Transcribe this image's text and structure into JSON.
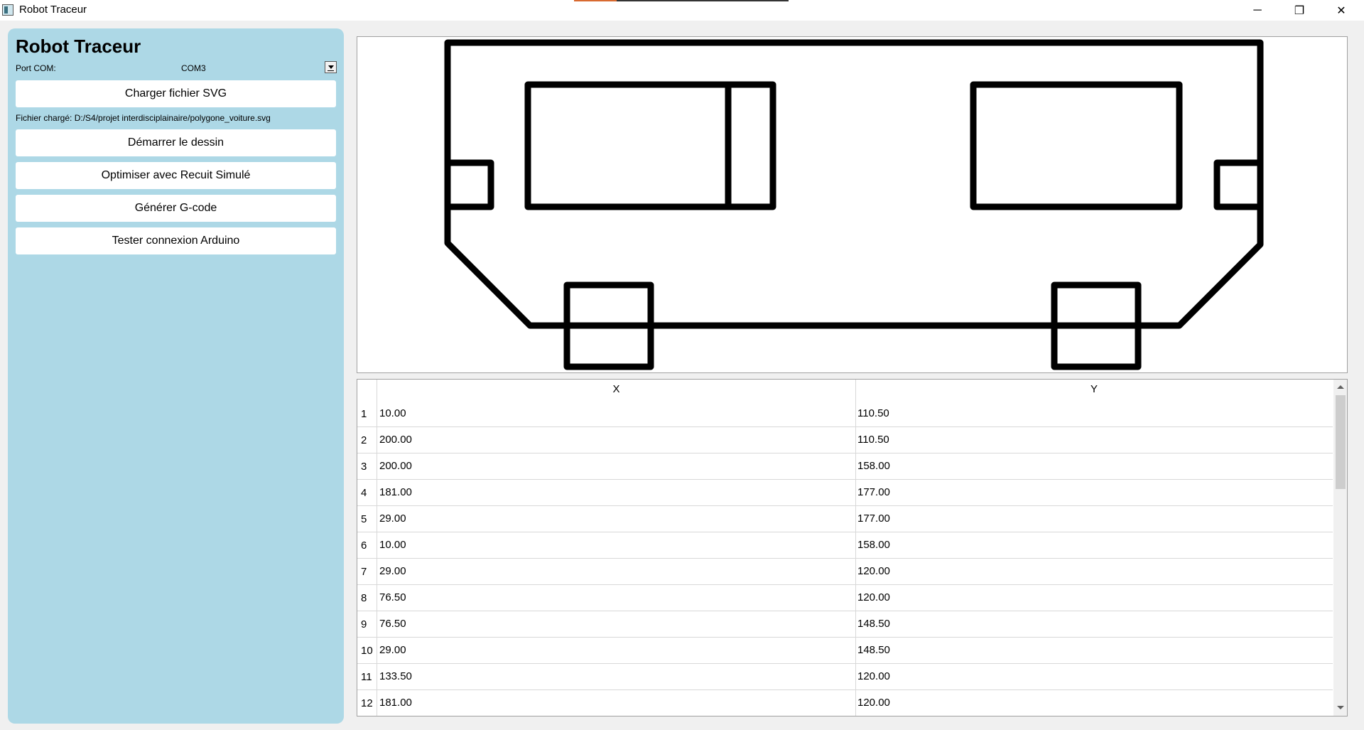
{
  "window": {
    "title": "Robot Traceur",
    "minimize_glyph": "─",
    "maximize_glyph": "❐",
    "close_glyph": "✕"
  },
  "sidebar": {
    "title": "Robot Traceur",
    "port_label": "Port COM:",
    "port_value": "COM3",
    "load_button": "Charger fichier SVG",
    "loaded_file": "Fichier chargé: D:/S4/projet interdisciplainaire/polygone_voiture.svg",
    "start_button": "Démarrer le dessin",
    "optimize_button": "Optimiser avec Recuit Simulé",
    "gcode_button": "Générer G-code",
    "test_button": "Tester connexion Arduino",
    "background_color": "#add8e6"
  },
  "table": {
    "headers": [
      "X",
      "Y"
    ],
    "rows": [
      {
        "n": "1",
        "x": "10.00",
        "y": "110.50"
      },
      {
        "n": "2",
        "x": "200.00",
        "y": "110.50"
      },
      {
        "n": "3",
        "x": "200.00",
        "y": "158.00"
      },
      {
        "n": "4",
        "x": "181.00",
        "y": "177.00"
      },
      {
        "n": "5",
        "x": "29.00",
        "y": "177.00"
      },
      {
        "n": "6",
        "x": "10.00",
        "y": "158.00"
      },
      {
        "n": "7",
        "x": "29.00",
        "y": "120.00"
      },
      {
        "n": "8",
        "x": "76.50",
        "y": "120.00"
      },
      {
        "n": "9",
        "x": "76.50",
        "y": "148.50"
      },
      {
        "n": "10",
        "x": "29.00",
        "y": "148.50"
      },
      {
        "n": "11",
        "x": "133.50",
        "y": "120.00"
      },
      {
        "n": "12",
        "x": "181.00",
        "y": "120.00"
      }
    ]
  },
  "drawing": {
    "stroke_color": "#000000"
  }
}
